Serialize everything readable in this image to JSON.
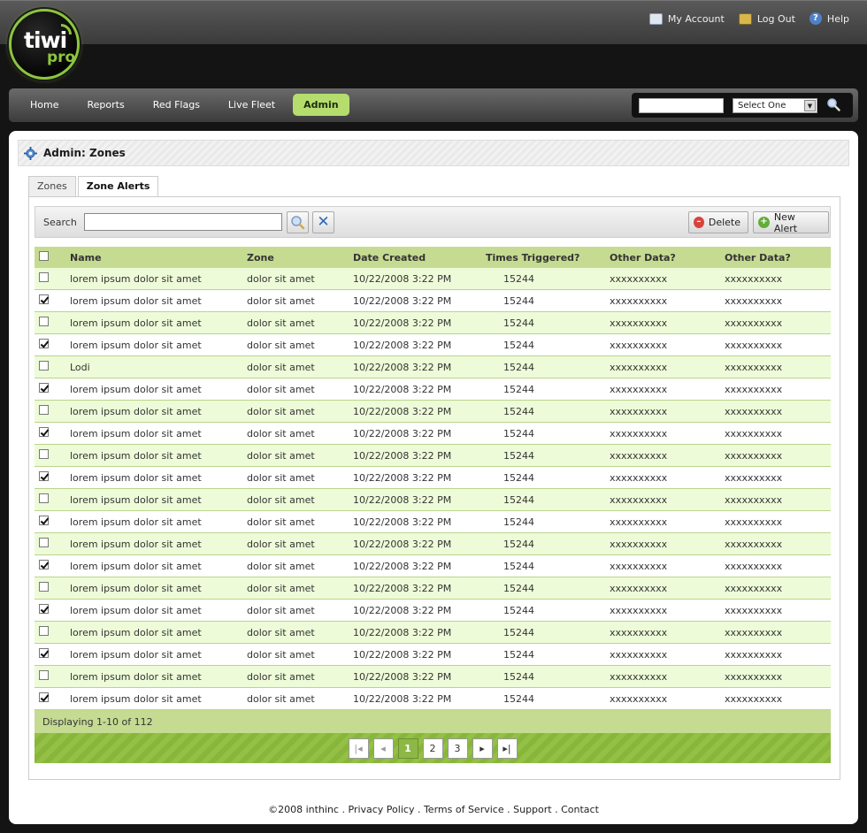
{
  "header": {
    "links": [
      {
        "label": "My Account",
        "icon": "account-icon"
      },
      {
        "label": "Log Out",
        "icon": "logout-icon"
      },
      {
        "label": "Help",
        "icon": "help-icon"
      }
    ],
    "logo": {
      "word1": "tiwi",
      "word2": "pro"
    }
  },
  "nav": {
    "items": [
      "Home",
      "Reports",
      "Red Flags",
      "Live Fleet",
      "Admin"
    ],
    "active": "Admin",
    "search_value": "",
    "select_value": "Select One"
  },
  "page": {
    "title": "Admin: Zones",
    "tabs": [
      "Zones",
      "Zone Alerts"
    ],
    "active_tab": "Zone Alerts"
  },
  "toolbar": {
    "search_label": "Search",
    "search_value": "",
    "delete_label": "Delete",
    "new_label": "New Alert"
  },
  "table": {
    "columns": [
      "Name",
      "Zone",
      "Date Created",
      "Times Triggered?",
      "Other Data?",
      "Other Data?"
    ],
    "rows": [
      {
        "checked": false,
        "name": "lorem ipsum dolor sit amet",
        "zone": "dolor sit amet",
        "date": "10/22/2008 3:22 PM",
        "times": "15244",
        "o1": "xxxxxxxxxx",
        "o2": "xxxxxxxxxx"
      },
      {
        "checked": true,
        "name": "lorem ipsum dolor sit amet",
        "zone": "dolor sit amet",
        "date": "10/22/2008 3:22 PM",
        "times": "15244",
        "o1": "xxxxxxxxxx",
        "o2": "xxxxxxxxxx"
      },
      {
        "checked": false,
        "name": "lorem ipsum dolor sit amet",
        "zone": "dolor sit amet",
        "date": "10/22/2008 3:22 PM",
        "times": "15244",
        "o1": "xxxxxxxxxx",
        "o2": "xxxxxxxxxx"
      },
      {
        "checked": true,
        "name": "lorem ipsum dolor sit amet",
        "zone": "dolor sit amet",
        "date": "10/22/2008 3:22 PM",
        "times": "15244",
        "o1": "xxxxxxxxxx",
        "o2": "xxxxxxxxxx"
      },
      {
        "checked": false,
        "name": "Lodi",
        "zone": "dolor sit amet",
        "date": "10/22/2008 3:22 PM",
        "times": "15244",
        "o1": "xxxxxxxxxx",
        "o2": "xxxxxxxxxx"
      },
      {
        "checked": true,
        "name": "lorem ipsum dolor sit amet",
        "zone": "dolor sit amet",
        "date": "10/22/2008 3:22 PM",
        "times": "15244",
        "o1": "xxxxxxxxxx",
        "o2": "xxxxxxxxxx"
      },
      {
        "checked": false,
        "name": "lorem ipsum dolor sit amet",
        "zone": "dolor sit amet",
        "date": "10/22/2008 3:22 PM",
        "times": "15244",
        "o1": "xxxxxxxxxx",
        "o2": "xxxxxxxxxx"
      },
      {
        "checked": true,
        "name": "lorem ipsum dolor sit amet",
        "zone": "dolor sit amet",
        "date": "10/22/2008 3:22 PM",
        "times": "15244",
        "o1": "xxxxxxxxxx",
        "o2": "xxxxxxxxxx"
      },
      {
        "checked": false,
        "name": "lorem ipsum dolor sit amet",
        "zone": "dolor sit amet",
        "date": "10/22/2008 3:22 PM",
        "times": "15244",
        "o1": "xxxxxxxxxx",
        "o2": "xxxxxxxxxx"
      },
      {
        "checked": true,
        "name": "lorem ipsum dolor sit amet",
        "zone": "dolor sit amet",
        "date": "10/22/2008 3:22 PM",
        "times": "15244",
        "o1": "xxxxxxxxxx",
        "o2": "xxxxxxxxxx"
      },
      {
        "checked": false,
        "name": "lorem ipsum dolor sit amet",
        "zone": "dolor sit amet",
        "date": "10/22/2008 3:22 PM",
        "times": "15244",
        "o1": "xxxxxxxxxx",
        "o2": "xxxxxxxxxx"
      },
      {
        "checked": true,
        "name": "lorem ipsum dolor sit amet",
        "zone": "dolor sit amet",
        "date": "10/22/2008 3:22 PM",
        "times": "15244",
        "o1": "xxxxxxxxxx",
        "o2": "xxxxxxxxxx"
      },
      {
        "checked": false,
        "name": "lorem ipsum dolor sit amet",
        "zone": "dolor sit amet",
        "date": "10/22/2008 3:22 PM",
        "times": "15244",
        "o1": "xxxxxxxxxx",
        "o2": "xxxxxxxxxx"
      },
      {
        "checked": true,
        "name": "lorem ipsum dolor sit amet",
        "zone": "dolor sit amet",
        "date": "10/22/2008 3:22 PM",
        "times": "15244",
        "o1": "xxxxxxxxxx",
        "o2": "xxxxxxxxxx"
      },
      {
        "checked": false,
        "name": "lorem ipsum dolor sit amet",
        "zone": "dolor sit amet",
        "date": "10/22/2008 3:22 PM",
        "times": "15244",
        "o1": "xxxxxxxxxx",
        "o2": "xxxxxxxxxx"
      },
      {
        "checked": true,
        "name": "lorem ipsum dolor sit amet",
        "zone": "dolor sit amet",
        "date": "10/22/2008 3:22 PM",
        "times": "15244",
        "o1": "xxxxxxxxxx",
        "o2": "xxxxxxxxxx"
      },
      {
        "checked": false,
        "name": "lorem ipsum dolor sit amet",
        "zone": "dolor sit amet",
        "date": "10/22/2008 3:22 PM",
        "times": "15244",
        "o1": "xxxxxxxxxx",
        "o2": "xxxxxxxxxx"
      },
      {
        "checked": true,
        "name": "lorem ipsum dolor sit amet",
        "zone": "dolor sit amet",
        "date": "10/22/2008 3:22 PM",
        "times": "15244",
        "o1": "xxxxxxxxxx",
        "o2": "xxxxxxxxxx"
      },
      {
        "checked": false,
        "name": "lorem ipsum dolor sit amet",
        "zone": "dolor sit amet",
        "date": "10/22/2008 3:22 PM",
        "times": "15244",
        "o1": "xxxxxxxxxx",
        "o2": "xxxxxxxxxx"
      },
      {
        "checked": true,
        "name": "lorem ipsum dolor sit amet",
        "zone": "dolor sit amet",
        "date": "10/22/2008 3:22 PM",
        "times": "15244",
        "o1": "xxxxxxxxxx",
        "o2": "xxxxxxxxxx"
      }
    ],
    "status": "Displaying 1-10 of 112"
  },
  "pager": {
    "pages": [
      "1",
      "2",
      "3"
    ],
    "current": "1"
  },
  "footer": {
    "items": [
      "©2008 inthinc",
      "Privacy Policy",
      "Terms of Service",
      "Support",
      "Contact"
    ],
    "separator": " . "
  },
  "colors": {
    "accent": "#8cc63f",
    "header_row": "#c6db92",
    "alt_row": "#eefbd8"
  }
}
